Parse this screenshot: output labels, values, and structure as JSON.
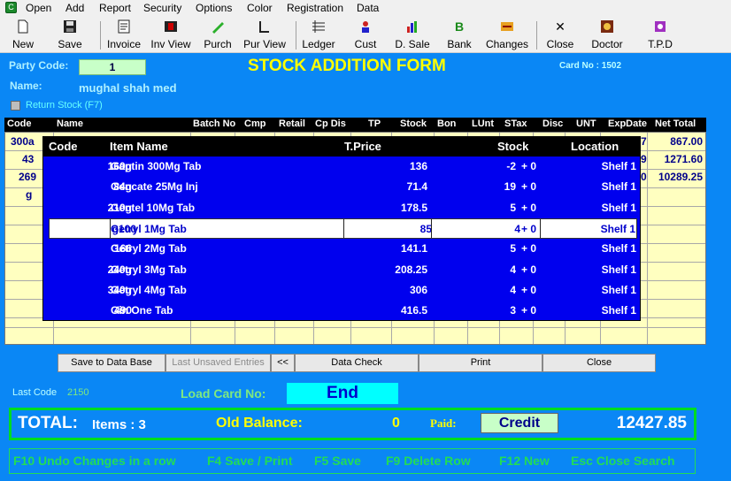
{
  "menu": [
    "Open",
    "Add",
    "Report",
    "Security",
    "Options",
    "Color",
    "Registration",
    "Data"
  ],
  "toolbar": [
    {
      "label": "New",
      "icon": "new-document-icon"
    },
    {
      "label": "Save",
      "icon": "save-disk-icon"
    },
    {
      "label": "Invoice",
      "icon": "invoice-icon"
    },
    {
      "label": "Inv View",
      "icon": "invoice-view-icon"
    },
    {
      "label": "Purch",
      "icon": "purchase-icon"
    },
    {
      "label": "Pur View",
      "icon": "purchase-view-icon"
    },
    {
      "label": "Ledger",
      "icon": "ledger-icon"
    },
    {
      "label": "Cust",
      "icon": "customer-icon"
    },
    {
      "label": "D. Sale",
      "icon": "daily-sale-chart-icon"
    },
    {
      "label": "Bank",
      "icon": "bank-icon"
    },
    {
      "label": "Changes",
      "icon": "changes-icon"
    },
    {
      "label": "Close",
      "icon": "close-x-icon"
    },
    {
      "label": "Doctor",
      "icon": "doctor-icon"
    },
    {
      "label": "T.P.D",
      "icon": "tpd-icon"
    }
  ],
  "form": {
    "party_code_label": "Party Code:",
    "party_code": "1",
    "title": "STOCK ADDITION FORM",
    "card_no": "Card No : 1502",
    "name_label": "Name:",
    "party_name": "mughal shah med",
    "return_stock_label": "Return Stock  (F7)"
  },
  "grid": {
    "columns": [
      "Code",
      "Name",
      "Batch No",
      "Cmp",
      "Retail",
      "Cp Dis",
      "TP",
      "Stock",
      "Bon",
      "LUnt",
      "STax",
      "Disc",
      "UNT",
      "ExpDate",
      "Net Total"
    ],
    "code_cells": [
      "300a",
      "43",
      "269",
      "g"
    ],
    "expdate_cells": [
      "7",
      "9",
      "0"
    ],
    "net_totals": [
      "867.00",
      "1271.60",
      "10289.25"
    ]
  },
  "popup": {
    "columns": [
      "Code",
      "Item Name",
      "T.Price",
      "Stock",
      "Location"
    ],
    "selected_index": 3,
    "rows": [
      {
        "code": "160g",
        "name": "Gaptin 300Mg Tab",
        "price": "136",
        "stock": "-2",
        "bonus": "+ 0",
        "location": "Shelf 1"
      },
      {
        "code": "84g",
        "name": "Gencate 25Mg Inj",
        "price": "71.4",
        "stock": "19",
        "bonus": "+ 0",
        "location": "Shelf 1"
      },
      {
        "code": "210g",
        "name": "Gentel 10Mg Tab",
        "price": "178.5",
        "stock": "5",
        "bonus": "+ 0",
        "location": "Shelf 1"
      },
      {
        "code": "g100",
        "name": "Getryl 1Mg Tab",
        "price": "85",
        "stock": "4",
        "bonus": "+ 0",
        "location": "Shelf 1"
      },
      {
        "code": "166",
        "name": "Getryl 2Mg Tab",
        "price": "141.1",
        "stock": "5",
        "bonus": "+ 0",
        "location": "Shelf 1"
      },
      {
        "code": "240g",
        "name": "Getryl 3Mg Tab",
        "price": "208.25",
        "stock": "4",
        "bonus": "+ 0",
        "location": "Shelf 1"
      },
      {
        "code": "340g",
        "name": "Getryl 4Mg Tab",
        "price": "306",
        "stock": "4",
        "bonus": "+ 0",
        "location": "Shelf 1"
      },
      {
        "code": "490",
        "name": "Gin One Tab",
        "price": "416.5",
        "stock": "3",
        "bonus": "+ 0",
        "location": "Shelf 1"
      }
    ]
  },
  "buttons": {
    "save_db": "Save to Data Base",
    "last_unsaved": "Last Unsaved Entries",
    "prev": "<<",
    "data_check": "Data Check",
    "print": "Print",
    "close": "Close"
  },
  "footer": {
    "last_code_label": "Last Code",
    "last_code": "2150",
    "load_card_label": "Load Card No:",
    "load_card_value": "End",
    "total_label": "TOTAL:",
    "items": "Items : 3",
    "old_balance_label": "Old Balance:",
    "old_balance": "0",
    "paid_label": "Paid:",
    "paid_mode": "Credit",
    "grand_total": "12427.85"
  },
  "shortcuts": [
    "F10 Undo Changes in a row",
    "F4 Save / Print",
    "F5 Save",
    "F9 Delete Row",
    "F12 New",
    "Esc Close Search"
  ],
  "colors": {
    "background": "#0a87f5",
    "title": "#ffff00",
    "popup": "#0000ee",
    "grid": "#ffffc0",
    "accent_green": "#22dd55"
  }
}
